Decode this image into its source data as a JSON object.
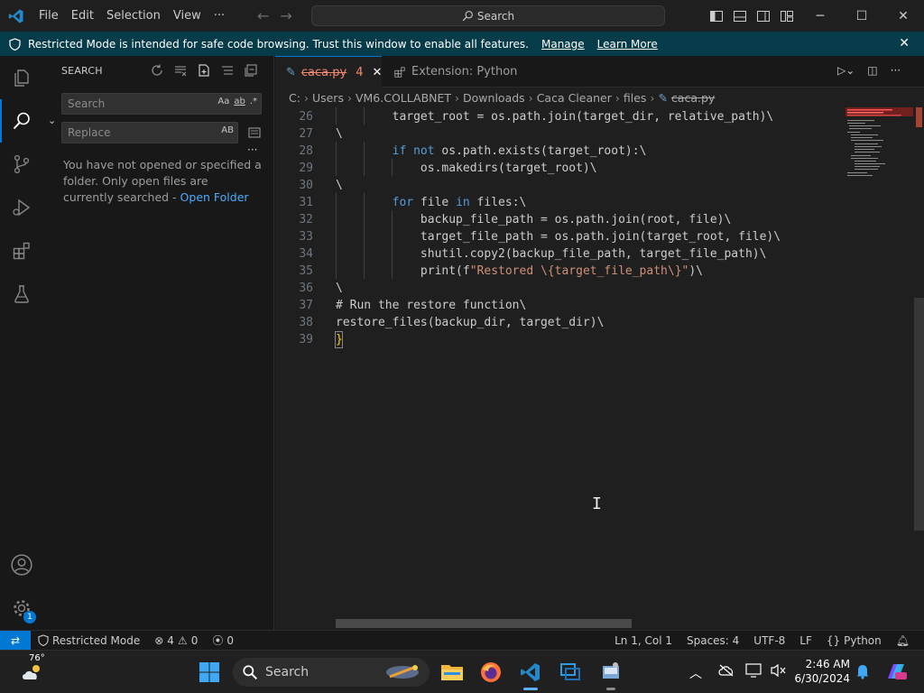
{
  "titlebar": {
    "menu": [
      "File",
      "Edit",
      "Selection",
      "View"
    ],
    "more": "···",
    "search_placeholder": "Search"
  },
  "banner": {
    "message": "Restricted Mode is intended for safe code browsing. Trust this window to enable all features.",
    "manage": "Manage",
    "learn_more": "Learn More"
  },
  "sidebar": {
    "title": "SEARCH",
    "search_placeholder": "Search",
    "search_opts": [
      "Aa",
      "ab",
      ".*"
    ],
    "replace_placeholder": "Replace",
    "replace_opt": "AB",
    "message": "You have not opened or specified a folder. Only open files are currently searched - ",
    "open_folder": "Open Folder"
  },
  "tabs": [
    {
      "label": "caca.py",
      "problems": "4",
      "active": true
    },
    {
      "label": "Extension: Python",
      "active": false
    }
  ],
  "breadcrumbs": [
    "C:",
    "Users",
    "VM6.COLLABNET",
    "Downloads",
    "Caca Cleaner",
    "files",
    "caca.py"
  ],
  "code_lines": [
    {
      "n": "26",
      "tokens": [
        [
          "        target_root = os.path.join(target_dir, relative_path)\\",
          "#cccccc"
        ]
      ]
    },
    {
      "n": "27",
      "tokens": [
        [
          "\\",
          "#cccccc"
        ]
      ]
    },
    {
      "n": "28",
      "tokens": [
        [
          "        ",
          "#cccccc"
        ],
        [
          "if not",
          "#569cd6"
        ],
        [
          " os.path.exists(target_root):\\",
          "#cccccc"
        ]
      ]
    },
    {
      "n": "29",
      "tokens": [
        [
          "            os.makedirs(target_root)\\",
          "#cccccc"
        ]
      ]
    },
    {
      "n": "30",
      "tokens": [
        [
          "\\",
          "#cccccc"
        ]
      ]
    },
    {
      "n": "31",
      "tokens": [
        [
          "        ",
          "#cccccc"
        ],
        [
          "for",
          "#569cd6"
        ],
        [
          " file ",
          "#cccccc"
        ],
        [
          "in",
          "#569cd6"
        ],
        [
          " files:\\",
          "#cccccc"
        ]
      ]
    },
    {
      "n": "32",
      "tokens": [
        [
          "            backup_file_path = os.path.join(root, file)\\",
          "#cccccc"
        ]
      ]
    },
    {
      "n": "33",
      "tokens": [
        [
          "            target_file_path = os.path.join(target_root, file)\\",
          "#cccccc"
        ]
      ]
    },
    {
      "n": "34",
      "tokens": [
        [
          "            shutil.copy2(backup_file_path, target_file_path)\\",
          "#cccccc"
        ]
      ]
    },
    {
      "n": "35",
      "tokens": [
        [
          "            print(f",
          "#cccccc"
        ],
        [
          "\"Restored \\{target_file_path\\}\"",
          "#ce9178"
        ],
        [
          ")\\",
          "#cccccc"
        ]
      ]
    },
    {
      "n": "36",
      "tokens": [
        [
          "\\",
          "#cccccc"
        ]
      ]
    },
    {
      "n": "37",
      "tokens": [
        [
          "# Run the restore function\\",
          "#cccccc"
        ]
      ]
    },
    {
      "n": "38",
      "tokens": [
        [
          "restore_files(backup_dir, target_dir)\\",
          "#cccccc"
        ]
      ]
    },
    {
      "n": "39",
      "tokens": [
        [
          "}",
          "#ffd700"
        ]
      ]
    }
  ],
  "statusbar": {
    "restricted": "Restricted Mode",
    "errors": "4",
    "warnings": "0",
    "ports": "0",
    "position": "Ln 1, Col 1",
    "spaces": "Spaces: 4",
    "encoding": "UTF-8",
    "eol": "LF",
    "language": "Python"
  },
  "taskbar": {
    "weather": "76°",
    "search": "Search",
    "time": "2:46 AM",
    "date": "6/30/2024"
  },
  "colors": {
    "accent": "#0078d4",
    "banner_bg": "#063b49",
    "tab_modified": "#f48771",
    "keyword": "#569cd6",
    "string": "#ce9178",
    "link": "#4daafc"
  },
  "settings_badge": "1"
}
